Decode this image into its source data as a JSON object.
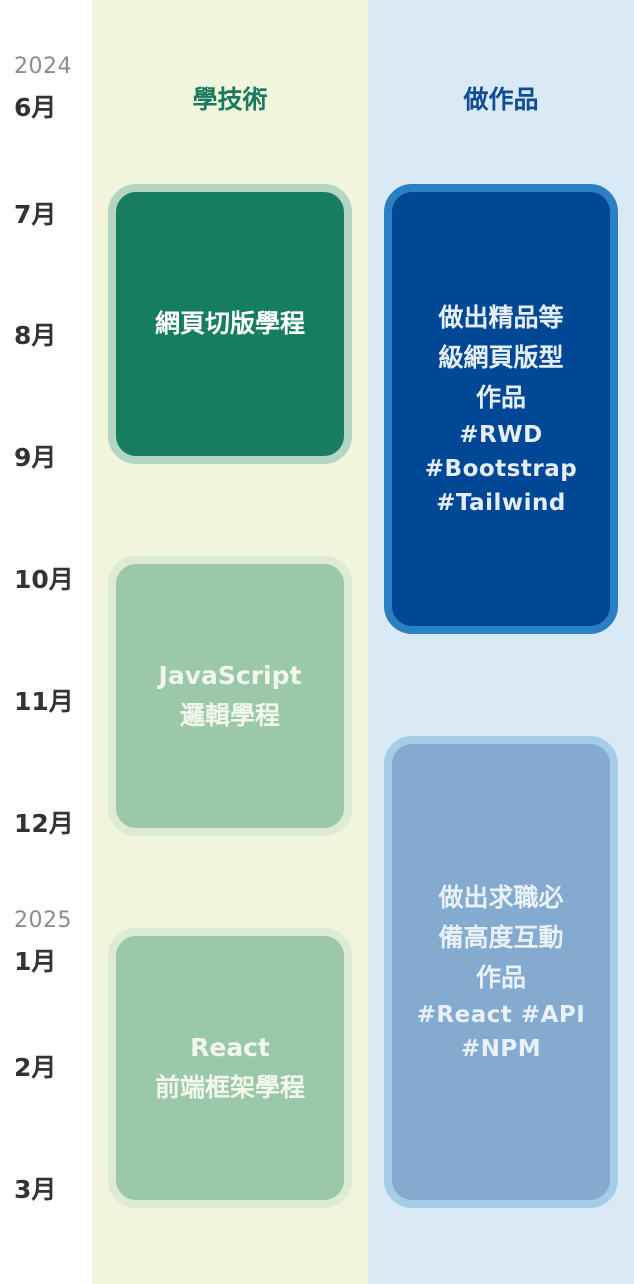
{
  "timeline": {
    "years": [
      "2024",
      "2025"
    ],
    "months": [
      "6月",
      "7月",
      "8月",
      "9月",
      "10月",
      "11月",
      "12月",
      "1月",
      "2月",
      "3月"
    ]
  },
  "columns": {
    "tech": "學技術",
    "work": "做作品"
  },
  "cards": {
    "html_css": {
      "line1": "網頁切版學程"
    },
    "javascript": {
      "line1": "JavaScript",
      "line2": "邏輯學程"
    },
    "react": {
      "line1": "React",
      "line2": "前端框架學程"
    },
    "portfolio1": {
      "line1": "做出精品等",
      "line2": "級網頁版型",
      "line3": "作品",
      "tags": [
        "#RWD",
        "#Bootstrap",
        "#Tailwind"
      ]
    },
    "portfolio2": {
      "line1": "做出求職必",
      "line2": "備高度互動",
      "line3": "作品",
      "tags": [
        "#React #API",
        "#NPM"
      ]
    }
  },
  "colors": {
    "tech_column_bg": "#f0f5db",
    "work_column_bg": "#d9eaf6",
    "tech_header": "#1a7a5e",
    "work_header": "#0e4e96",
    "card_dark_green": "#167d5f",
    "card_light_green": "#9bc8a9",
    "card_dark_blue": "#004896",
    "card_light_blue": "#84aacf"
  }
}
